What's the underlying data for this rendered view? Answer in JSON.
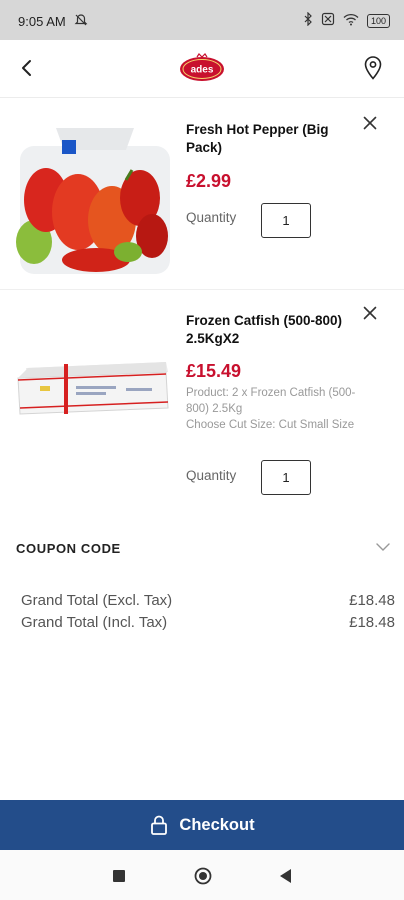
{
  "status_bar": {
    "time": "9:05 AM",
    "left_icon": "alarm-off-icon",
    "right_icons": [
      "bluetooth-icon",
      "sim-off-icon",
      "wifi-icon"
    ],
    "battery": "100"
  },
  "header": {
    "back_icon": "chevron-left-icon",
    "logo_text": "ades",
    "store_icon": "location-pin-icon"
  },
  "cart_items": [
    {
      "name": "Fresh Hot Pepper (Big Pack)",
      "price": "£2.99",
      "options": [],
      "quantity_label": "Quantity",
      "quantity": "1"
    },
    {
      "name": "Frozen Catfish (500-800) 2.5KgX2",
      "price": "£15.49",
      "options": [
        "Product: 2 x Frozen Catfish (500-800) 2.5Kg",
        "Choose Cut Size: Cut Small Size"
      ],
      "quantity_label": "Quantity",
      "quantity": "1"
    }
  ],
  "coupon": {
    "label": "COUPON CODE",
    "icon": "chevron-down-icon"
  },
  "totals": [
    {
      "label": "Grand Total (Excl. Tax)",
      "value": "£18.48"
    },
    {
      "label": "Grand Total (Incl. Tax)",
      "value": "£18.48"
    }
  ],
  "checkout": {
    "label": "Checkout",
    "icon": "lock-icon",
    "color": "#234d8a"
  },
  "colors": {
    "price": "#c8102e",
    "brand": "#c8102e"
  },
  "nav_bar": {
    "icons": [
      "recents-square-icon",
      "home-circle-icon",
      "back-triangle-icon"
    ]
  }
}
